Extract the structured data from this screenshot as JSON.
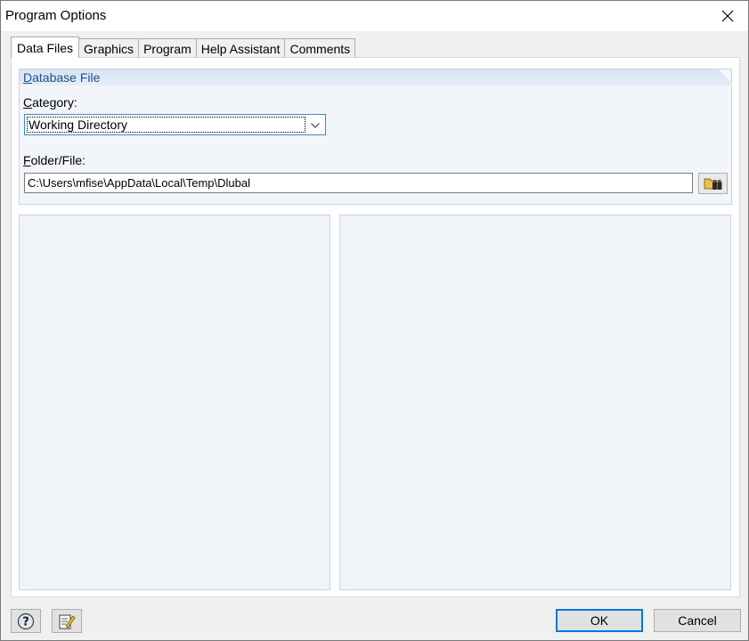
{
  "window": {
    "title": "Program Options"
  },
  "tabs": [
    {
      "label": "Data Files",
      "active": true
    },
    {
      "label": "Graphics",
      "active": false
    },
    {
      "label": "Program",
      "active": false
    },
    {
      "label": "Help Assistant",
      "active": false
    },
    {
      "label": "Comments",
      "active": false
    }
  ],
  "database_group": {
    "title_first": "D",
    "title_rest": "atabase File",
    "category_label_first": "C",
    "category_label_rest": "ategory:",
    "category_value": "Working Directory",
    "folder_label_first": "F",
    "folder_label_rest": "older/File:",
    "folder_value": "C:\\Users\\mfise\\AppData\\Local\\Temp\\Dlubal"
  },
  "footer": {
    "ok_label": "OK",
    "cancel_label": "Cancel"
  },
  "icons": {
    "close": "close-icon",
    "combo_arrow": "chevron-down-icon",
    "browse": "folder-binoculars-icon",
    "help": "help-icon",
    "edit": "edit-note-icon"
  },
  "colors": {
    "group_header": "#d8e4f3",
    "group_title": "#1f4f8f",
    "default_button_border": "#0078d7"
  }
}
